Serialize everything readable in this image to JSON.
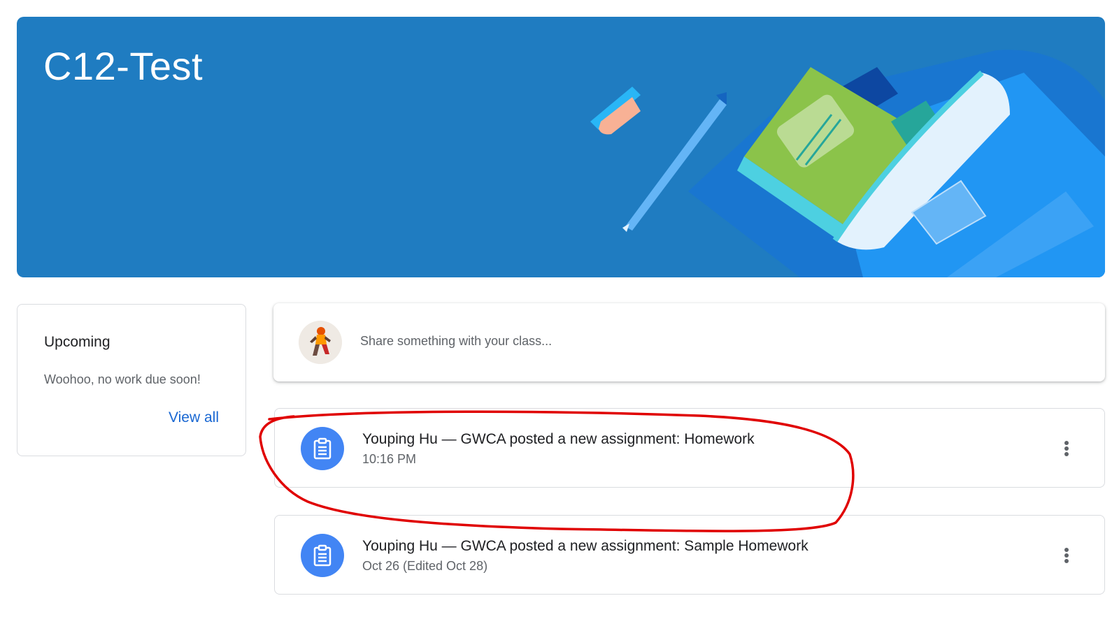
{
  "banner": {
    "class_name": "C12-Test"
  },
  "upcoming": {
    "title": "Upcoming",
    "message": "Woohoo, no work due soon!",
    "view_all_label": "View all"
  },
  "share_box": {
    "placeholder": "Share something with your class..."
  },
  "stream": {
    "posts": [
      {
        "title": "Youping Hu — GWCA posted a new assignment: Homework",
        "time": "10:16 PM",
        "icon": "assignment-icon"
      },
      {
        "title": "Youping Hu — GWCA posted a new assignment: Sample Homework",
        "time": "Oct 26 (Edited Oct 28)",
        "icon": "assignment-icon"
      }
    ]
  },
  "annotation": {
    "color": "#e00000",
    "shape": "hand-drawn-circle",
    "highlights": "first-post"
  },
  "colors": {
    "banner_bg": "#1f7cc1",
    "accent_blue": "#4285f4",
    "link_blue": "#1967d2"
  }
}
